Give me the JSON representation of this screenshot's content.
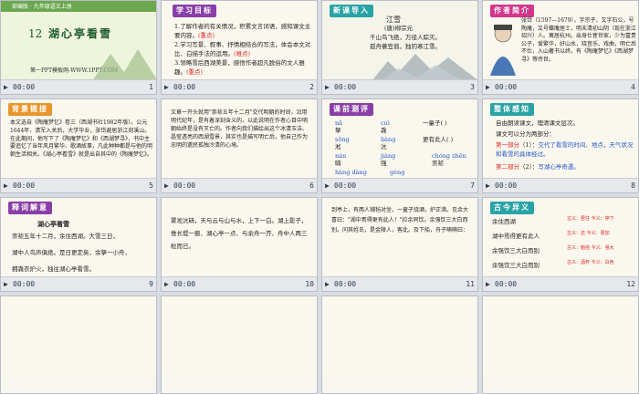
{
  "slides": [
    {
      "num": "1",
      "time": "00:00",
      "badge": "部编版 · 九年级语文上册",
      "title_num": "12",
      "title": "湖心亭看雪",
      "site": "第一PPT模板网-WWW.1PPT.COM"
    },
    {
      "num": "2",
      "time": "00:00",
      "tag": "学习目标",
      "items": [
        {
          "text": "1.了解作者的有关情况，积累文言词语，感知课文主要内容。",
          "note": "(重点)"
        },
        {
          "text": "2.学习写景、叙事、抒情相结合的写法，体会本文对比、白描手法的运用。",
          "note": "(难点)"
        },
        {
          "text": "3.领略雪后西湖美景，感悟作者超凡脱俗的文人雅趣。",
          "note": "(重点)"
        }
      ]
    },
    {
      "num": "3",
      "time": "00:00",
      "tag": "新课导入",
      "poem_title": "江雪",
      "poem_author": "(唐)柳宗元",
      "poem_lines": [
        "千山鸟飞绝，万径人踪灭。",
        "孤舟蓑笠翁，独钓寒江雪。"
      ]
    },
    {
      "num": "4",
      "time": "00:00",
      "tag": "作者简介",
      "bio": "张岱（1597—1679），字宗子，又字石公，号陶庵，又号蝶庵居士，明末清初山阴（现在浙江绍兴）人。寓居杭州。出身仕宦世家，少为富贵公子，爱繁华，好山水，晓音乐、戏曲，明亡后不仕，入山著书以终。有《陶庵梦忆》《西湖梦寻》等传世。"
    },
    {
      "num": "5",
      "time": "00:00",
      "tag": "背景链接",
      "text": "本文选自《陶庵梦忆》卷三（西湖书社1982年版）。公元1644年，清军入关后，大学毕业，张岱避居浙江剡溪山。在此期间，他写下了《陶庵梦忆》和《西湖梦寻》，书中主要追忆了当年风月繁华、歌酒故事，凡此种种都是与他的明朝生活相关。《湖心亭看雪》就是出自其中的《陶庵梦忆》。"
    },
    {
      "num": "6",
      "time": "00:00",
      "text": "文章一开头就用\"崇祯五年十二月\"交代明朝的时间，沿用明代纪年，是有着深刻含义的，以此说明在作者心目中明朝始终是没有灭亡的。作者向我们描绘出这个冰清玉洁、晶莹透亮的西湖雪景，其实也是描写明亡后，他自己作为忠明的遗民孤独冷清的心境。"
    },
    {
      "num": "7",
      "time": "00:00",
      "tag": "课前测评",
      "pairs": [
        {
          "py": "nǎ",
          "w": "拏"
        },
        {
          "py": "cuì",
          "w": "毳"
        },
        {
          "py": "sōng",
          "w": "淞"
        },
        {
          "py": "hàng",
          "w": "沆"
        },
        {
          "py": "nán",
          "w": "喃"
        },
        {
          "py": "jiàng",
          "w": "强"
        },
        {
          "py": "chóng zhēn",
          "w": "崇祯"
        },
        {
          "py": "hàng dàng",
          "w": "沆砀"
        },
        {
          "py": "gèng",
          "w": "更"
        }
      ],
      "ex1": "一童子(   )",
      "ex2": "更有此人(   )"
    },
    {
      "num": "8",
      "time": "00:00",
      "tag": "整体感知",
      "line1": "自由朗读课文，理清课文层次。",
      "line2": "课文可以分为两部分：",
      "part1_label": "第一部分",
      "part1_range": "（1）：",
      "part1_text": "交代了看雪的时间、地点，天气状况和看雪的具体经过。",
      "part2_label": "第二部分",
      "part2_range": "（2）：",
      "part2_text": "写湖心亭奇遇。"
    },
    {
      "num": "9",
      "time": "00:00",
      "tag": "释词解意",
      "title": "湖心亭看雪",
      "lines": [
        "崇祯五年十二月，余住西湖。大雪三日，",
        "湖中人鸟声俱绝。是日更定矣，余拏一小舟，",
        "拥毳衣炉火，独往湖心亭看雪。"
      ]
    },
    {
      "num": "10",
      "time": "00:00",
      "text": "雾凇沆砀，天与云与山与水，上下一白。湖上影子，惟长堤一痕、湖心亭一点、与余舟一芥、舟中人两三粒而已。"
    },
    {
      "num": "11",
      "time": "00:00",
      "text": "到亭上，有两人铺毡对坐，一童子烧酒，炉正沸。见余大喜曰：\"湖中焉得更有此人！\"拉余同饮。余强饮三大白而别。问其姓氏，是金陵人，客此。及下船，舟子喃喃曰："
    },
    {
      "num": "12",
      "time": "00:00",
      "tag": "古今异义",
      "rows": [
        {
          "text": "余住西湖",
          "old": "古义：居住",
          "new": "今义：停下"
        },
        {
          "text": "湖中焉得更有此人",
          "old": "古义：还",
          "new": "今义：更加"
        },
        {
          "text": "余强饮三大白而别",
          "old": "古义：勉强",
          "new": "今义：强大"
        },
        {
          "text": "余强饮三大白而别",
          "old": "古义：酒杯",
          "new": "今义：白色"
        }
      ]
    }
  ],
  "colors": {
    "red": "#dd2222",
    "blue": "#2457c5",
    "tag_purple": "#8a3fa8",
    "tag_pink": "#d4368c",
    "tag_teal": "#2aa3a6",
    "tag_orange": "#e8962b"
  }
}
